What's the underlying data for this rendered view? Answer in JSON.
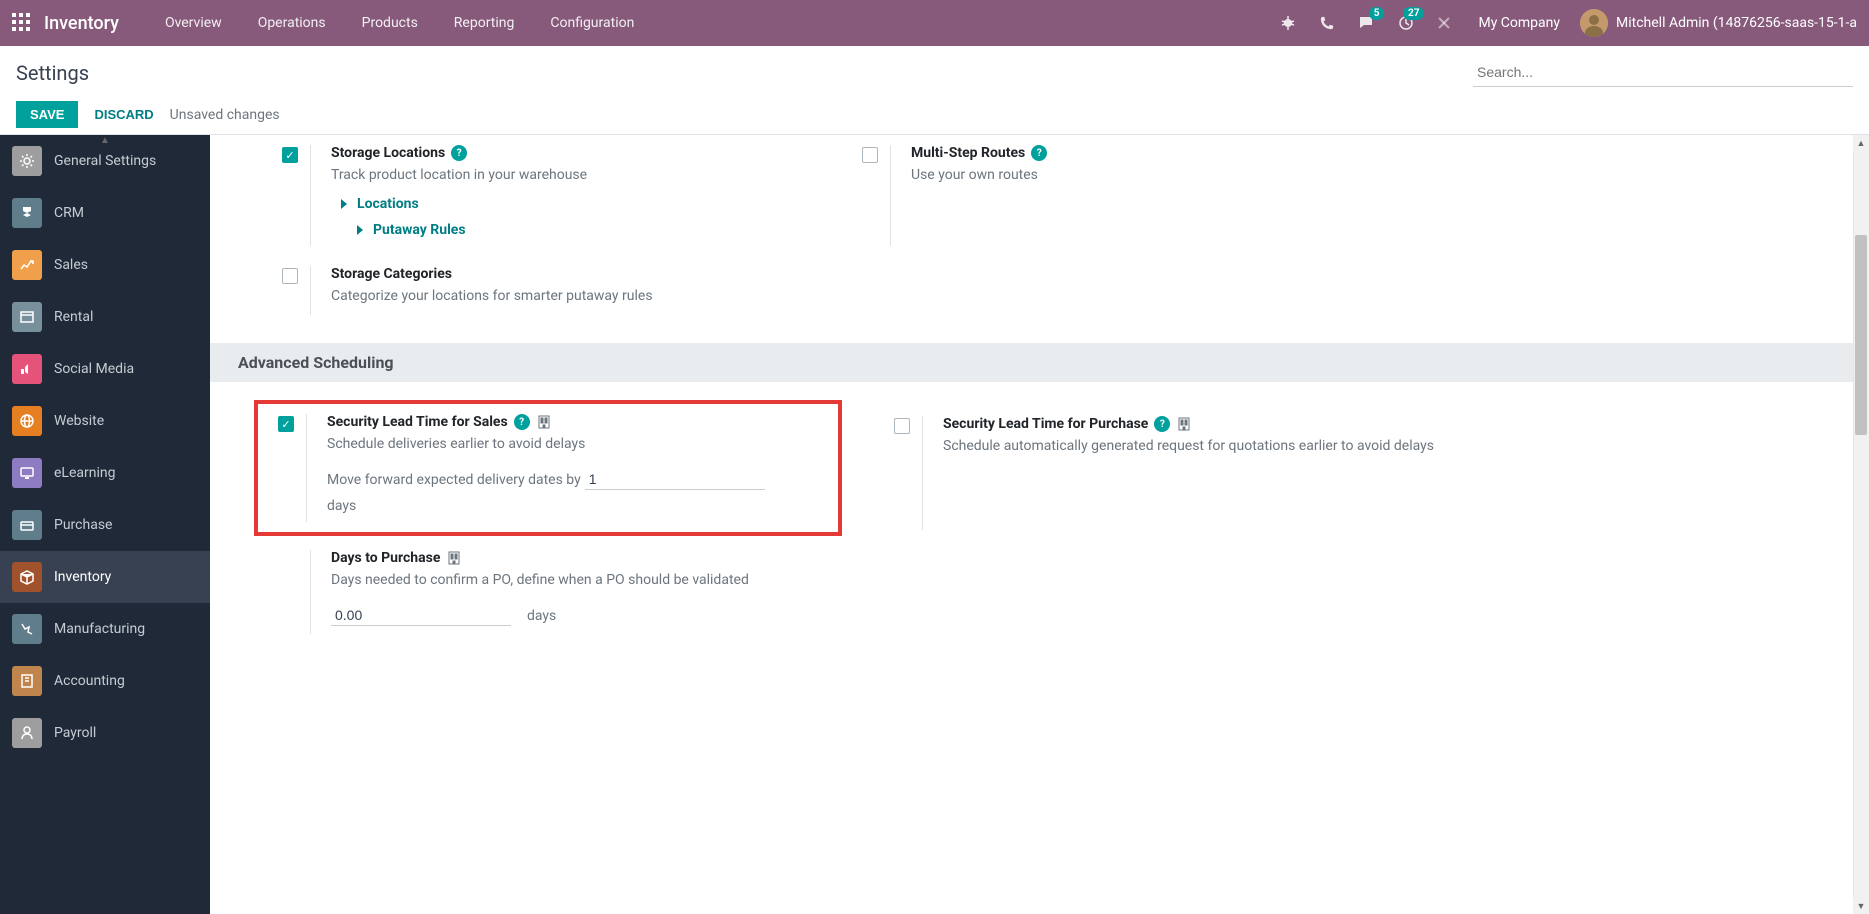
{
  "nav": {
    "app_name": "Inventory",
    "menu": [
      "Overview",
      "Operations",
      "Products",
      "Reporting",
      "Configuration"
    ],
    "messages_badge": "5",
    "activities_badge": "27",
    "company": "My Company",
    "user": "Mitchell Admin (14876256-saas-15-1-a"
  },
  "control": {
    "title": "Settings",
    "save": "SAVE",
    "discard": "DISCARD",
    "unsaved": "Unsaved changes",
    "search_placeholder": "Search..."
  },
  "sidebar": [
    {
      "label": "General Settings",
      "bg": "#9e9e9e"
    },
    {
      "label": "CRM",
      "bg": "#607d8b"
    },
    {
      "label": "Sales",
      "bg": "#f0a04b"
    },
    {
      "label": "Rental",
      "bg": "#78909c"
    },
    {
      "label": "Social Media",
      "bg": "#e6537a"
    },
    {
      "label": "Website",
      "bg": "#e67e22"
    },
    {
      "label": "eLearning",
      "bg": "#8e7cc3"
    },
    {
      "label": "Purchase",
      "bg": "#607d8b"
    },
    {
      "label": "Inventory",
      "bg": "#a0522d",
      "active": true
    },
    {
      "label": "Manufacturing",
      "bg": "#607d8b"
    },
    {
      "label": "Accounting",
      "bg": "#c0844d"
    },
    {
      "label": "Payroll",
      "bg": "#9e9e9e"
    }
  ],
  "settings": {
    "storage_locations": {
      "title": "Storage Locations",
      "desc": "Track product location in your warehouse",
      "link1": "Locations",
      "link2": "Putaway Rules"
    },
    "multi_step": {
      "title": "Multi-Step Routes",
      "desc": "Use your own routes"
    },
    "storage_categories": {
      "title": "Storage Categories",
      "desc": "Categorize your locations for smarter putaway rules"
    },
    "section_advanced": "Advanced Scheduling",
    "sec_lead_sales": {
      "title": "Security Lead Time for Sales",
      "desc": "Schedule deliveries earlier to avoid delays",
      "extra_pre": "Move forward expected delivery dates by",
      "value": "1",
      "extra_post": "days"
    },
    "sec_lead_purchase": {
      "title": "Security Lead Time for Purchase",
      "desc": "Schedule automatically generated request for quotations earlier to avoid delays"
    },
    "days_purchase": {
      "title": "Days to Purchase",
      "desc": "Days needed to confirm a PO, define when a PO should be validated",
      "value": "0.00",
      "unit": "days"
    }
  }
}
